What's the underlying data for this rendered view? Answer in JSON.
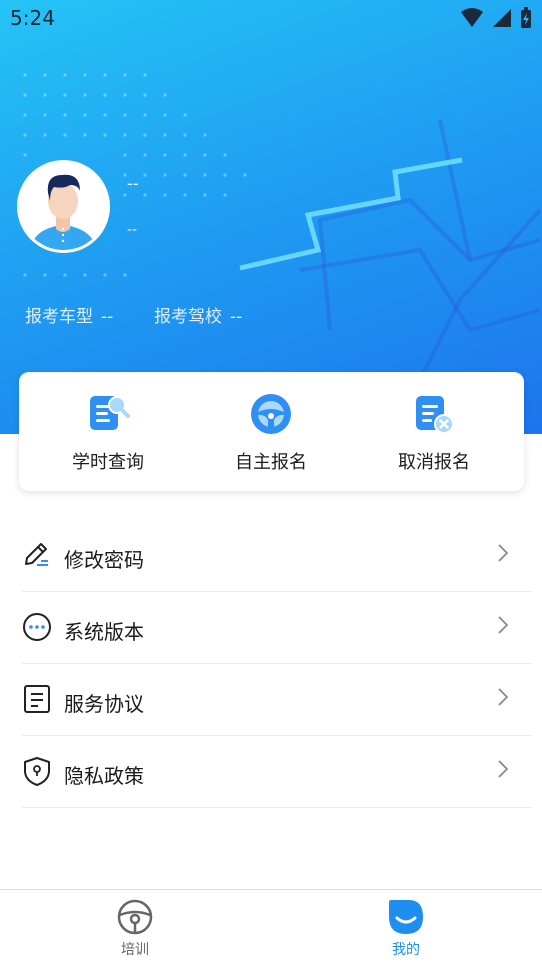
{
  "status_bar": {
    "time": "5:24"
  },
  "profile": {
    "name": "--",
    "subtitle": "--",
    "license_type_label": "报考车型",
    "license_type_value": "--",
    "school_label": "报考驾校",
    "school_value": "--"
  },
  "quick_actions": [
    {
      "label": "学时查询",
      "icon": "study-hours-search-icon"
    },
    {
      "label": "自主报名",
      "icon": "steering-wheel-icon"
    },
    {
      "label": "取消报名",
      "icon": "cancel-registration-icon"
    }
  ],
  "menu": [
    {
      "label": "修改密码",
      "icon": "pencil-icon"
    },
    {
      "label": "系统版本",
      "icon": "more-dots-icon"
    },
    {
      "label": "服务协议",
      "icon": "document-icon"
    },
    {
      "label": "隐私政策",
      "icon": "shield-icon"
    }
  ],
  "bottom_nav": {
    "tabs": [
      {
        "label": "培训",
        "icon": "steering-wheel-icon",
        "active": false
      },
      {
        "label": "我的",
        "icon": "profile-face-icon",
        "active": true
      }
    ]
  },
  "colors": {
    "accent": "#1e8ff0",
    "gradient_start": "#25c4f6",
    "gradient_end": "#1d74ee",
    "inactive_tab": "#666666"
  }
}
